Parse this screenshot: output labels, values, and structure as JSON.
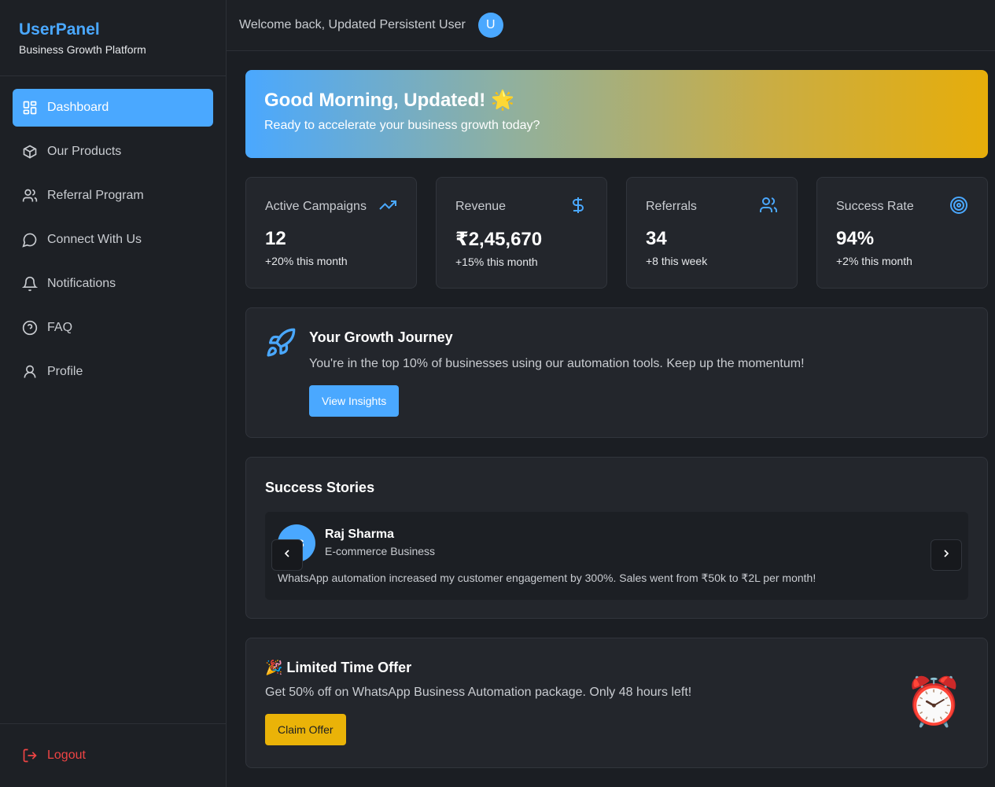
{
  "brand": {
    "title": "UserPanel",
    "subtitle": "Business Growth Platform"
  },
  "sidebar": {
    "items": [
      {
        "label": "Dashboard",
        "icon": "dashboard-icon",
        "active": true
      },
      {
        "label": "Our Products",
        "icon": "package-icon"
      },
      {
        "label": "Referral Program",
        "icon": "users-icon"
      },
      {
        "label": "Connect With Us",
        "icon": "chat-icon"
      },
      {
        "label": "Notifications",
        "icon": "bell-icon"
      },
      {
        "label": "FAQ",
        "icon": "help-icon"
      },
      {
        "label": "Profile",
        "icon": "user-icon"
      }
    ],
    "logout_label": "Logout"
  },
  "header": {
    "welcome": "Welcome back, Updated Persistent User",
    "avatar_initial": "U"
  },
  "hero": {
    "title": "Good Morning, Updated! 🌟",
    "subtitle": "Ready to accelerate your business growth today?"
  },
  "stats": [
    {
      "label": "Active Campaigns",
      "value": "12",
      "change": "+20% this month",
      "icon": "trending-up-icon"
    },
    {
      "label": "Revenue",
      "value": "₹2,45,670",
      "change": "+15% this month",
      "icon": "dollar-icon"
    },
    {
      "label": "Referrals",
      "value": "34",
      "change": "+8 this week",
      "icon": "users-icon"
    },
    {
      "label": "Success Rate",
      "value": "94%",
      "change": "+2% this month",
      "icon": "target-icon"
    }
  ],
  "growth": {
    "title": "Your Growth Journey",
    "text": "You're in the top 10% of businesses using our automation tools. Keep up the momentum!",
    "button": "View Insights"
  },
  "stories": {
    "title": "Success Stories",
    "current": {
      "initials": "RS",
      "name": "Raj Sharma",
      "business": "E-commerce Business",
      "quote": "WhatsApp automation increased my customer engagement by 300%. Sales went from ₹50k to ₹2L per month!"
    }
  },
  "offer": {
    "title": "🎉 Limited Time Offer",
    "text": "Get 50% off on WhatsApp Business Automation package. Only 48 hours left!",
    "button": "Claim Offer",
    "emoji": "⏰"
  },
  "colors": {
    "accent": "#4aa8ff",
    "warning": "#eab308",
    "danger": "#ef4444",
    "background": "#1b1e23"
  }
}
